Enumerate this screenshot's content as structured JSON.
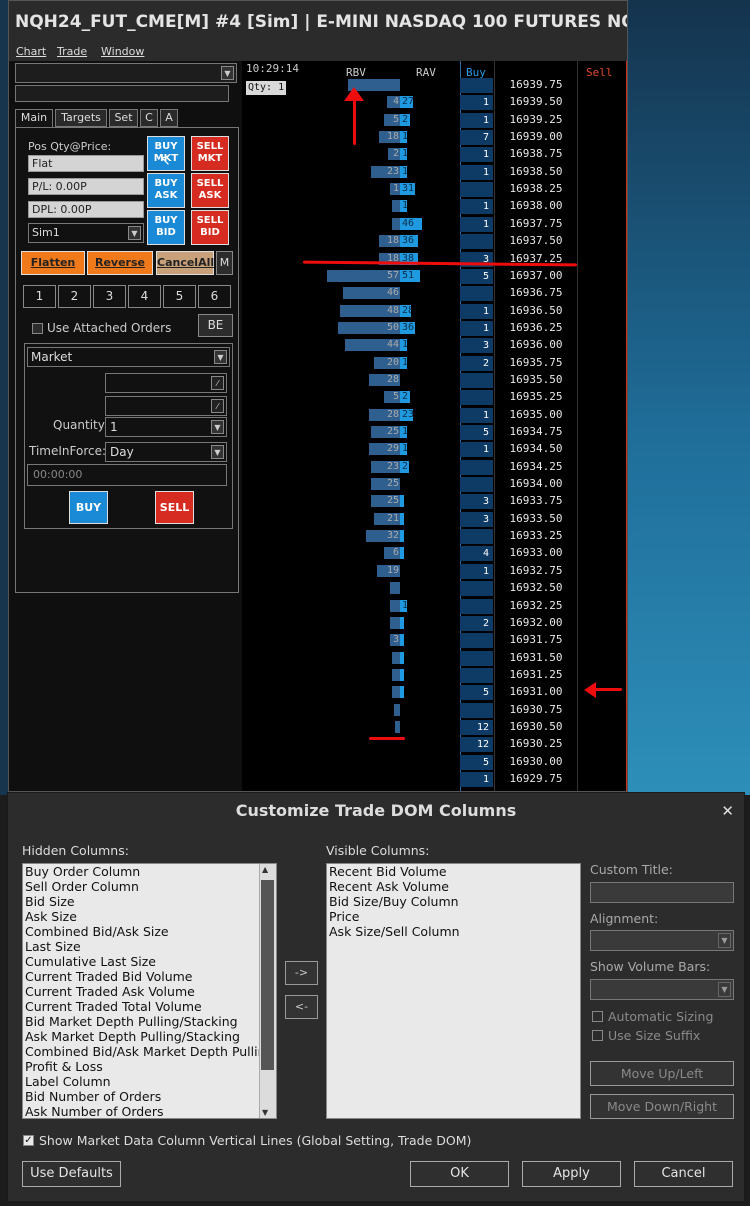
{
  "window": {
    "title": "NQH24_FUT_CME[M] #4 [Sim]  | E-MINI NASDAQ 100 FUTURES NQ M..."
  },
  "menu": [
    "Chart",
    "Trade",
    "Window"
  ],
  "left_panel": {
    "tabs": [
      "Main",
      "Targets",
      "Set",
      "C",
      "A"
    ],
    "pos_qty_label": "Pos Qty@Price:",
    "pos_value": "Flat",
    "pl_value": "P/L: 0.00P",
    "dpl_value": "DPL: 0.00P",
    "account": "Sim1",
    "buttons": {
      "buy_mkt": "BUY MKT",
      "sell_mkt": "SELL MKT",
      "buy_ask": "BUY ASK",
      "sell_ask": "SELL ASK",
      "buy_bid": "BUY BID",
      "sell_bid": "SELL BID"
    },
    "flatten": "Flatten",
    "reverse": "Reverse",
    "cancel_all": "CancelAll",
    "m_button": "M",
    "quantity_buttons": [
      "1",
      "2",
      "3",
      "4",
      "5",
      "6"
    ],
    "use_attached_orders": "Use Attached Orders",
    "be_button": "BE",
    "order_type": "Market",
    "quantity_label": "Quantity:",
    "quantity_value": "1",
    "tif_label": "TimeInForce:",
    "tif_value": "Day",
    "time_value": "00:00:00",
    "buy": "BUY",
    "sell": "SELL"
  },
  "ladder": {
    "time": "10:29:14",
    "qty_label": "Qty: 1",
    "headers": {
      "rbv": "RBV",
      "rav": "RAV",
      "buy": "Buy",
      "sell": "Sell"
    },
    "rows": [
      {
        "price": "16939.75",
        "buy": "",
        "rbv": "",
        "rav": "",
        "rbv_w": 40,
        "rav_w": 0
      },
      {
        "price": "16939.50",
        "buy": "1",
        "rbv": "4",
        "rav": "27",
        "rbv_w": 10,
        "rav_w": 12
      },
      {
        "price": "16939.25",
        "buy": "1",
        "rbv": "5",
        "rav": "2",
        "rbv_w": 12,
        "rav_w": 9
      },
      {
        "price": "16939.00",
        "buy": "7",
        "rbv": "18",
        "rav": "1",
        "rbv_w": 16,
        "rav_w": 6
      },
      {
        "price": "16938.75",
        "buy": "1",
        "rbv": "2",
        "rav": "1",
        "rbv_w": 9,
        "rav_w": 6
      },
      {
        "price": "16938.50",
        "buy": "1",
        "rbv": "23",
        "rav": "1",
        "rbv_w": 22,
        "rav_w": 6
      },
      {
        "price": "16938.25",
        "buy": "",
        "rbv": "1",
        "rav": "31",
        "rbv_w": 8,
        "rav_w": 14
      },
      {
        "price": "16938.00",
        "buy": "1",
        "rbv": "",
        "rav": "1",
        "rbv_w": 6,
        "rav_w": 6
      },
      {
        "price": "16937.75",
        "buy": "1",
        "rbv": "",
        "rav": "46",
        "rbv_w": 6,
        "rav_w": 20
      },
      {
        "price": "16937.50",
        "buy": "",
        "rbv": "18",
        "rav": "36",
        "rbv_w": 16,
        "rav_w": 16
      },
      {
        "price": "16937.25",
        "buy": "3",
        "rbv": "18",
        "rav": "38",
        "rbv_w": 16,
        "rav_w": 16
      },
      {
        "price": "16937.00",
        "buy": "5",
        "rbv": "57",
        "rav": "51",
        "rbv_w": 56,
        "rav_w": 18
      },
      {
        "price": "16936.75",
        "buy": "",
        "rbv": "46",
        "rav": "",
        "rbv_w": 44,
        "rav_w": 0
      },
      {
        "price": "16936.50",
        "buy": "1",
        "rbv": "48",
        "rav": "28",
        "rbv_w": 46,
        "rav_w": 10
      },
      {
        "price": "16936.25",
        "buy": "1",
        "rbv": "50",
        "rav": "36",
        "rbv_w": 48,
        "rav_w": 14
      },
      {
        "price": "16936.00",
        "buy": "3",
        "rbv": "44",
        "rav": "1",
        "rbv_w": 42,
        "rav_w": 6
      },
      {
        "price": "16935.75",
        "buy": "2",
        "rbv": "20",
        "rav": "1",
        "rbv_w": 20,
        "rav_w": 6
      },
      {
        "price": "16935.50",
        "buy": "",
        "rbv": "28",
        "rav": "",
        "rbv_w": 24,
        "rav_w": 0
      },
      {
        "price": "16935.25",
        "buy": "",
        "rbv": "5",
        "rav": "2",
        "rbv_w": 12,
        "rav_w": 9
      },
      {
        "price": "16935.00",
        "buy": "1",
        "rbv": "28",
        "rav": "23",
        "rbv_w": 24,
        "rav_w": 12
      },
      {
        "price": "16934.75",
        "buy": "5",
        "rbv": "25",
        "rav": "1",
        "rbv_w": 22,
        "rav_w": 6
      },
      {
        "price": "16934.50",
        "buy": "1",
        "rbv": "29",
        "rav": "1",
        "rbv_w": 24,
        "rav_w": 6
      },
      {
        "price": "16934.25",
        "buy": "",
        "rbv": "23",
        "rav": "2",
        "rbv_w": 22,
        "rav_w": 8
      },
      {
        "price": "16934.00",
        "buy": "",
        "rbv": "25",
        "rav": "",
        "rbv_w": 22,
        "rav_w": 0
      },
      {
        "price": "16933.75",
        "buy": "3",
        "rbv": "25",
        "rav": "",
        "rbv_w": 22,
        "rav_w": 4
      },
      {
        "price": "16933.50",
        "buy": "3",
        "rbv": "21",
        "rav": "",
        "rbv_w": 20,
        "rav_w": 4
      },
      {
        "price": "16933.25",
        "buy": "",
        "rbv": "32",
        "rav": "",
        "rbv_w": 26,
        "rav_w": 4
      },
      {
        "price": "16933.00",
        "buy": "4",
        "rbv": "6",
        "rav": "",
        "rbv_w": 12,
        "rav_w": 4
      },
      {
        "price": "16932.75",
        "buy": "1",
        "rbv": "19",
        "rav": "",
        "rbv_w": 18,
        "rav_w": 0
      },
      {
        "price": "16932.50",
        "buy": "",
        "rbv": "",
        "rav": "",
        "rbv_w": 8,
        "rav_w": 0
      },
      {
        "price": "16932.25",
        "buy": "",
        "rbv": "",
        "rav": "1",
        "rbv_w": 8,
        "rav_w": 6
      },
      {
        "price": "16932.00",
        "buy": "2",
        "rbv": "",
        "rav": "",
        "rbv_w": 8,
        "rav_w": 4
      },
      {
        "price": "16931.75",
        "buy": "",
        "rbv": "3",
        "rav": "",
        "rbv_w": 8,
        "rav_w": 4
      },
      {
        "price": "16931.50",
        "buy": "",
        "rbv": "",
        "rav": "",
        "rbv_w": 6,
        "rav_w": 4
      },
      {
        "price": "16931.25",
        "buy": "",
        "rbv": "",
        "rav": "",
        "rbv_w": 6,
        "rav_w": 4
      },
      {
        "price": "16931.00",
        "buy": "5",
        "rbv": "",
        "rav": "",
        "rbv_w": 6,
        "rav_w": 4
      },
      {
        "price": "16930.75",
        "buy": "",
        "rbv": "",
        "rav": "",
        "rbv_w": 5,
        "rav_w": 0
      },
      {
        "price": "16930.50",
        "buy": "12",
        "rbv": "",
        "rav": "",
        "rbv_w": 4,
        "rav_w": 0
      },
      {
        "price": "16930.25",
        "buy": "12",
        "rbv": "",
        "rav": "",
        "rbv_w": 0,
        "rav_w": 0
      },
      {
        "price": "16930.00",
        "buy": "5",
        "rbv": "",
        "rav": "",
        "rbv_w": 0,
        "rav_w": 0
      },
      {
        "price": "16929.75",
        "buy": "1",
        "rbv": "",
        "rav": "",
        "rbv_w": 0,
        "rav_w": 0
      }
    ]
  },
  "dialog": {
    "title": "Customize Trade DOM Columns",
    "hidden_label": "Hidden Columns:",
    "visible_label": "Visible Columns:",
    "hidden_columns": [
      "Buy Order Column",
      "Sell Order Column",
      "Bid Size",
      "Ask Size",
      "Combined Bid/Ask Size",
      "Last Size",
      "Cumulative Last Size",
      "Current Traded Bid Volume",
      "Current Traded Ask Volume",
      "Current Traded Total Volume",
      "Bid Market Depth Pulling/Stacking",
      "Ask Market Depth Pulling/Stacking",
      "Combined Bid/Ask Market Depth Pulling/Stacking",
      "Profit & Loss",
      "Label Column",
      "Bid Number of Orders",
      "Ask Number of Orders"
    ],
    "visible_columns": [
      "Recent Bid Volume",
      "Recent Ask Volume",
      "Bid Size/Buy Column",
      "Price",
      "Ask Size/Sell Column"
    ],
    "add_arrow": "->",
    "remove_arrow": "<-",
    "custom_title_label": "Custom Title:",
    "alignment_label": "Alignment:",
    "show_volume_bars_label": "Show Volume Bars:",
    "automatic_sizing": "Automatic Sizing",
    "use_size_suffix": "Use Size Suffix",
    "move_up": "Move Up/Left",
    "move_down": "Move Down/Right",
    "show_lines": "Show Market Data Column Vertical Lines (Global Setting, Trade DOM)",
    "use_defaults": "Use Defaults",
    "ok": "OK",
    "apply": "Apply",
    "cancel": "Cancel"
  }
}
